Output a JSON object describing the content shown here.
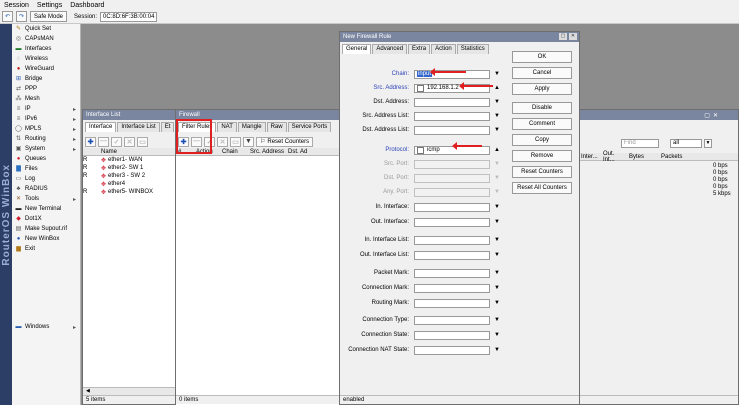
{
  "menu": [
    "Session",
    "Settings",
    "Dashboard"
  ],
  "toolbar": {
    "safe_mode": "Safe Mode",
    "session_label": "Session:",
    "session_value": "0C:8D:6F:3B:00:04"
  },
  "branding": "RouterOS WinBox",
  "sidebar": [
    {
      "label": "Quick Set",
      "icon": "wand-icon",
      "glyph": "✎",
      "color": "#b07a1a",
      "arrow": false
    },
    {
      "label": "CAPsMAN",
      "icon": "capsman-icon",
      "glyph": "◎",
      "color": "#666",
      "arrow": false
    },
    {
      "label": "Interfaces",
      "icon": "interfaces-icon",
      "glyph": "▬",
      "color": "#1f7a2a",
      "arrow": false
    },
    {
      "label": "Wireless",
      "icon": "wireless-icon",
      "glyph": "◌",
      "color": "#555",
      "arrow": false
    },
    {
      "label": "WireGuard",
      "icon": "wireguard-icon",
      "glyph": "●",
      "color": "#b22",
      "arrow": false
    },
    {
      "label": "Bridge",
      "icon": "bridge-icon",
      "glyph": "⊞",
      "color": "#2a5db0",
      "arrow": false
    },
    {
      "label": "PPP",
      "icon": "ppp-icon",
      "glyph": "⇄",
      "color": "#555",
      "arrow": false
    },
    {
      "label": "Mesh",
      "icon": "mesh-icon",
      "glyph": "⁂",
      "color": "#555",
      "arrow": false
    },
    {
      "label": "IP",
      "icon": "ip-icon",
      "glyph": "≡",
      "color": "#555",
      "arrow": true
    },
    {
      "label": "IPv6",
      "icon": "ipv6-icon",
      "glyph": "≡",
      "color": "#555",
      "arrow": true
    },
    {
      "label": "MPLS",
      "icon": "mpls-icon",
      "glyph": "◯",
      "color": "#555",
      "arrow": true
    },
    {
      "label": "Routing",
      "icon": "routing-icon",
      "glyph": "⇅",
      "color": "#555",
      "arrow": true
    },
    {
      "label": "System",
      "icon": "system-icon",
      "glyph": "▣",
      "color": "#555",
      "arrow": true
    },
    {
      "label": "Queues",
      "icon": "queues-icon",
      "glyph": "●",
      "color": "#c23",
      "arrow": false
    },
    {
      "label": "Files",
      "icon": "files-icon",
      "glyph": "▇",
      "color": "#2a6fc0",
      "arrow": false
    },
    {
      "label": "Log",
      "icon": "log-icon",
      "glyph": "▭",
      "color": "#555",
      "arrow": false
    },
    {
      "label": "RADIUS",
      "icon": "radius-icon",
      "glyph": "♣",
      "color": "#555",
      "arrow": false
    },
    {
      "label": "Tools",
      "icon": "tools-icon",
      "glyph": "✕",
      "color": "#8a5a2a",
      "arrow": true
    },
    {
      "label": "New Terminal",
      "icon": "terminal-icon",
      "glyph": "▬",
      "color": "#222",
      "arrow": false
    },
    {
      "label": "Dot1X",
      "icon": "dot1x-icon",
      "glyph": "◆",
      "color": "#c23",
      "arrow": false
    },
    {
      "label": "Make Supout.rif",
      "icon": "supout-icon",
      "glyph": "▤",
      "color": "#555",
      "arrow": false
    },
    {
      "label": "New WinBox",
      "icon": "winbox-icon",
      "glyph": "●",
      "color": "#2a5db0",
      "arrow": false
    },
    {
      "label": "Exit",
      "icon": "exit-icon",
      "glyph": "▆",
      "color": "#b07a1a",
      "arrow": false
    },
    {
      "label": "Windows",
      "icon": "windows-icon",
      "glyph": "▬",
      "color": "#2a5db0",
      "arrow": true
    }
  ],
  "interface_list": {
    "title": "Interface List",
    "tabs": [
      "Interface",
      "Interface List",
      "Et"
    ],
    "column": "Name",
    "rows": [
      {
        "flag": "R",
        "name": "ether1- WAN"
      },
      {
        "flag": "R",
        "name": "ether2- SW 1"
      },
      {
        "flag": "R",
        "name": "ether3 - SW 2"
      },
      {
        "flag": "",
        "name": "ether4"
      },
      {
        "flag": "R",
        "name": "ether5- WINBOX"
      }
    ],
    "status": "5 items"
  },
  "firewall": {
    "title": "Firewall",
    "tabs": [
      "Filter Rules",
      "NAT",
      "Mangle",
      "Raw",
      "Service Ports"
    ],
    "reset_counters": "Reset Counters",
    "columns": [
      "#",
      "Action",
      "Chain",
      "Src. Address",
      "Dst. Ad"
    ],
    "status": "0 items"
  },
  "right_panel": {
    "find_placeholder": "Find",
    "filter_value": "all",
    "columns": [
      "Inter...",
      "Out. Int...",
      "Bytes",
      "Packets"
    ],
    "rates": [
      "0 bps",
      "0 bps",
      "0 bps",
      "0 bps",
      "5 kbps"
    ]
  },
  "new_rule": {
    "title": "New Firewall Rule",
    "tabs": [
      "General",
      "Advanced",
      "Extra",
      "Action",
      "Statistics"
    ],
    "fields": [
      {
        "label": "Chain:",
        "value": "input",
        "style": "blue",
        "check": false,
        "disabled": false,
        "dd": "▼"
      },
      {
        "label": "Src. Address:",
        "value": "192.168.1.2",
        "style": "blue",
        "check": true,
        "disabled": false,
        "dd": "▲"
      },
      {
        "label": "Dst. Address:",
        "value": "",
        "style": "",
        "check": false,
        "disabled": false,
        "dd": "▼"
      },
      {
        "label": "Src. Address List:",
        "value": "",
        "style": "",
        "check": false,
        "disabled": false,
        "dd": "▼"
      },
      {
        "label": "Dst. Address List:",
        "value": "",
        "style": "",
        "check": false,
        "disabled": false,
        "dd": "▼"
      },
      {
        "label": "Protocol:",
        "value": "icmp",
        "style": "blue",
        "check": true,
        "disabled": false,
        "dd": "▲"
      },
      {
        "label": "Src. Port:",
        "value": "",
        "style": "gray",
        "check": false,
        "disabled": true,
        "dd": "▼"
      },
      {
        "label": "Dst. Port:",
        "value": "",
        "style": "gray",
        "check": false,
        "disabled": true,
        "dd": "▼"
      },
      {
        "label": "Any. Port:",
        "value": "",
        "style": "gray",
        "check": false,
        "disabled": true,
        "dd": "▼"
      },
      {
        "label": "In. Interface:",
        "value": "",
        "style": "",
        "check": false,
        "disabled": false,
        "dd": "▼"
      },
      {
        "label": "Out. Interface:",
        "value": "",
        "style": "",
        "check": false,
        "disabled": false,
        "dd": "▼"
      },
      {
        "label": "In. Interface List:",
        "value": "",
        "style": "",
        "check": false,
        "disabled": false,
        "dd": "▼"
      },
      {
        "label": "Out. Interface List:",
        "value": "",
        "style": "",
        "check": false,
        "disabled": false,
        "dd": "▼"
      },
      {
        "label": "Packet Mark:",
        "value": "",
        "style": "",
        "check": false,
        "disabled": false,
        "dd": "▼"
      },
      {
        "label": "Connection Mark:",
        "value": "",
        "style": "",
        "check": false,
        "disabled": false,
        "dd": "▼"
      },
      {
        "label": "Routing Mark:",
        "value": "",
        "style": "",
        "check": false,
        "disabled": false,
        "dd": "▼"
      },
      {
        "label": "Connection Type:",
        "value": "",
        "style": "",
        "check": false,
        "disabled": false,
        "dd": "▼"
      },
      {
        "label": "Connection State:",
        "value": "",
        "style": "",
        "check": false,
        "disabled": false,
        "dd": "▼"
      },
      {
        "label": "Connection NAT State:",
        "value": "",
        "style": "",
        "check": false,
        "disabled": false,
        "dd": "▼"
      }
    ],
    "buttons": [
      "OK",
      "Cancel",
      "Apply",
      "Disable",
      "Comment",
      "Copy",
      "Remove",
      "Reset Counters",
      "Reset All Counters"
    ],
    "status": "enabled"
  }
}
